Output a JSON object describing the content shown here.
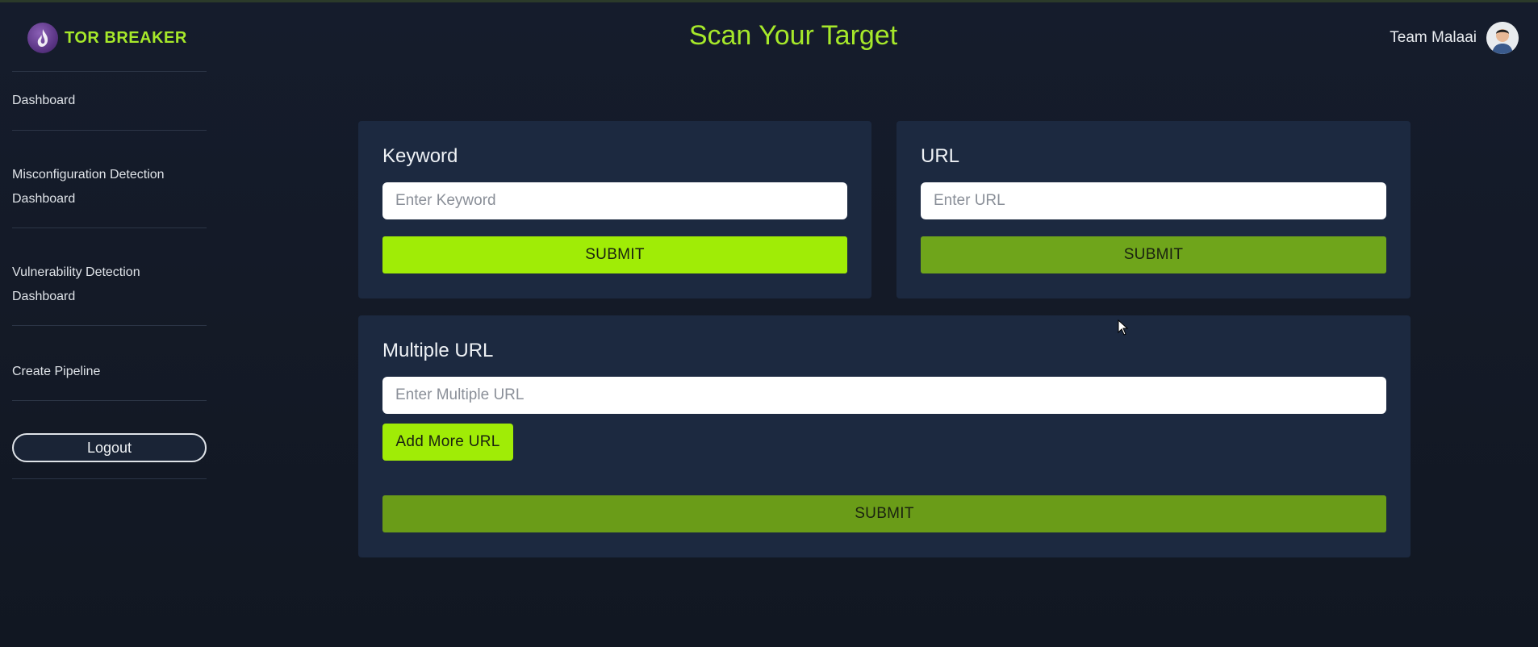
{
  "brand": {
    "name": "TOR BREAKER",
    "icon": "flame-logo-icon"
  },
  "header": {
    "title": "Scan Your Target"
  },
  "user": {
    "name": "Team Malaai",
    "avatar_icon": "user-avatar-icon"
  },
  "sidebar": {
    "items": [
      {
        "label": "Dashboard"
      },
      {
        "label_line1": "Misconfiguration Detection",
        "label_line2": "Dashboard"
      },
      {
        "label_line1": "Vulnerability Detection",
        "label_line2": "Dashboard"
      },
      {
        "label": "Create Pipeline"
      }
    ],
    "logout_label": "Logout"
  },
  "keyword_card": {
    "title": "Keyword",
    "placeholder": "Enter Keyword",
    "value": "",
    "submit_label": "SUBMIT"
  },
  "url_card": {
    "title": "URL",
    "placeholder": "Enter URL",
    "value": "",
    "submit_label": "SUBMIT"
  },
  "multi_url_card": {
    "title": "Multiple URL",
    "placeholder": "Enter Multiple URL",
    "value": "",
    "add_more_label": "Add More URL",
    "submit_label": "SUBMIT"
  },
  "colors": {
    "accent": "#a6e82a",
    "button_bright": "#a0ec06",
    "button_dark": "#6fa51b",
    "card_bg": "#1c2940",
    "page_bg": "#141a26"
  }
}
